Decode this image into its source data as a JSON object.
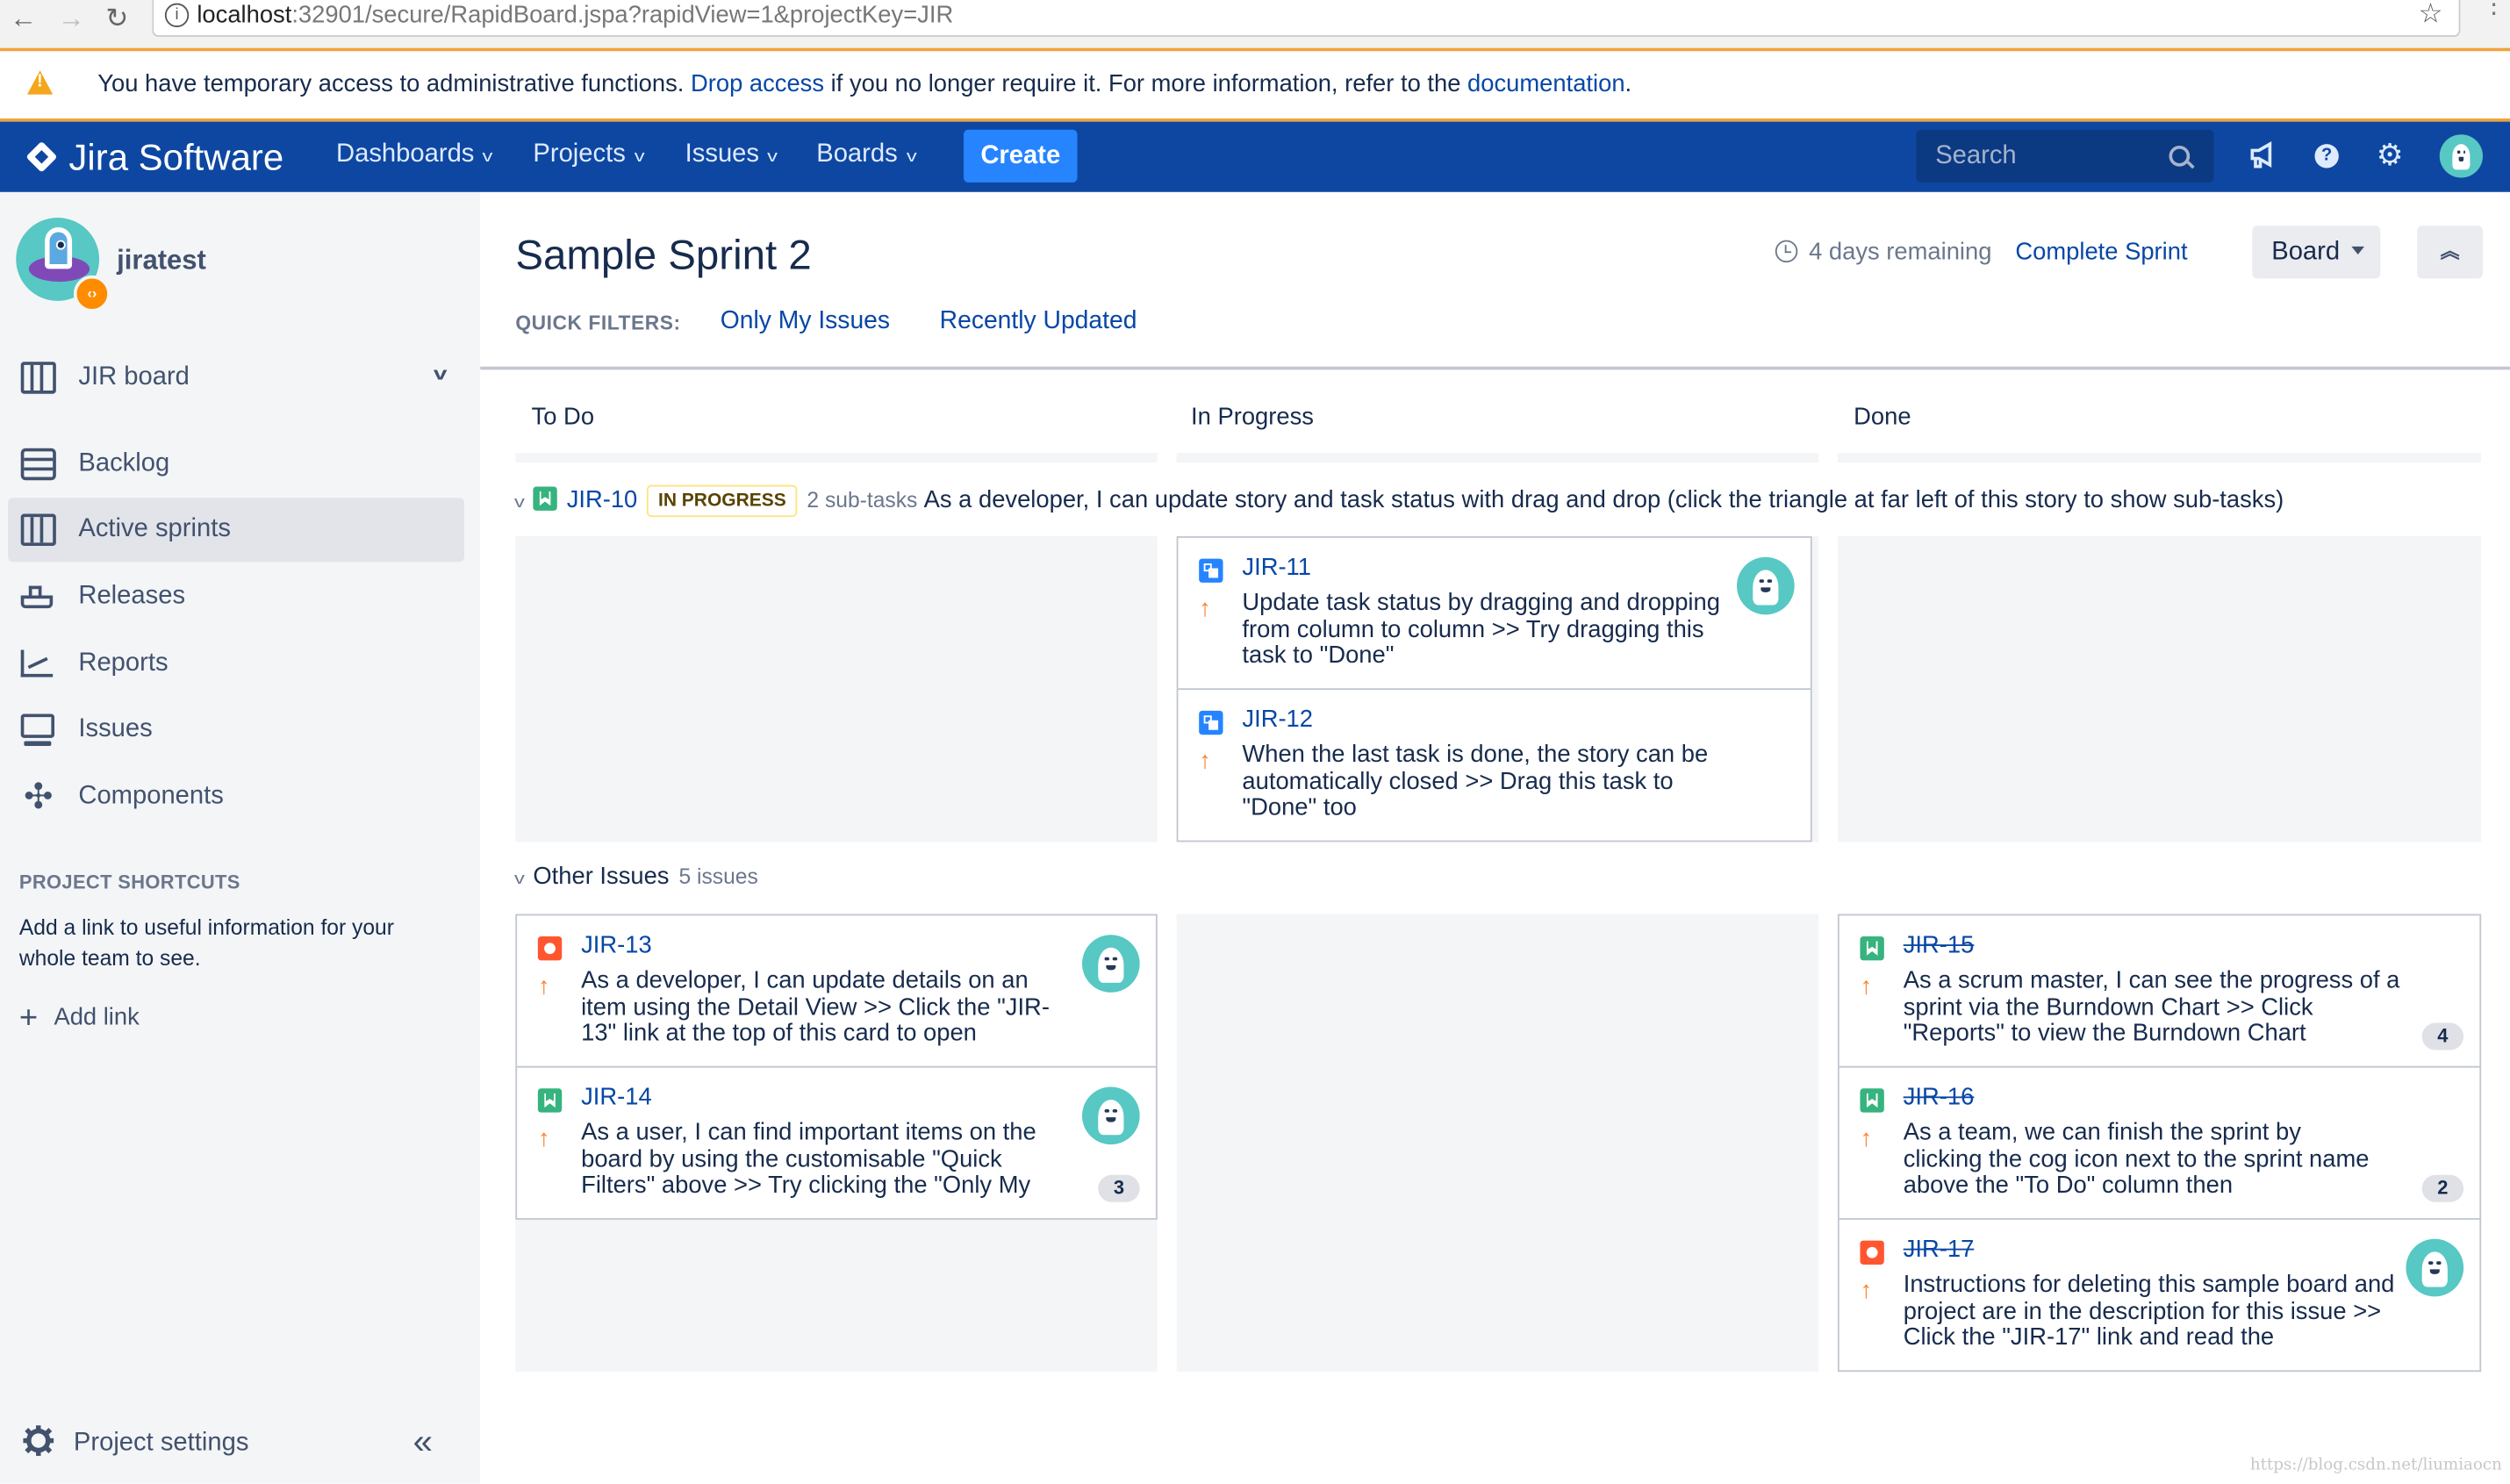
{
  "browser": {
    "url_host": "localhost",
    "url_rest": ":32901/secure/RapidBoard.jspa?rapidView=1&projectKey=JIR",
    "back_icon": "←",
    "forward_icon": "→",
    "reload_icon": "↻",
    "star_icon": "☆",
    "info_icon": "i",
    "menu_icon": "⋮"
  },
  "banner": {
    "text_before": "You have temporary access to administrative functions. ",
    "drop_access": "Drop access",
    "text_middle": " if you no longer require it. For more information, refer to the ",
    "documentation": "documentation",
    "text_after": "."
  },
  "topnav": {
    "logo": "Jira Software",
    "items": [
      {
        "label": "Dashboards",
        "chev": "v"
      },
      {
        "label": "Projects",
        "chev": "v"
      },
      {
        "label": "Issues",
        "chev": "v"
      },
      {
        "label": "Boards",
        "chev": "v"
      }
    ],
    "create": "Create",
    "search_placeholder": "Search",
    "notifications_icon": "megaphone",
    "help_icon": "?",
    "settings_icon": "⚙"
  },
  "sidebar": {
    "project_name": "jiratest",
    "project_badge": "‹›",
    "board": {
      "label": "JIR board",
      "chev": "v"
    },
    "items": [
      {
        "label": "Backlog",
        "icon": "backlog-icon"
      },
      {
        "label": "Active sprints",
        "icon": "sprint-icon",
        "active": true
      },
      {
        "label": "Releases",
        "icon": "release-icon"
      },
      {
        "label": "Reports",
        "icon": "reports-icon"
      },
      {
        "label": "Issues",
        "icon": "issues-icon"
      },
      {
        "label": "Components",
        "icon": "components-icon"
      }
    ],
    "components_glyph": "✣",
    "shortcuts_title": "PROJECT SHORTCUTS",
    "shortcuts_desc": "Add a link to useful information for your whole team to see.",
    "add_link": "Add link",
    "add_link_icon": "+",
    "project_settings": "Project settings",
    "collapse_icon": "«"
  },
  "main": {
    "sprint_title": "Sample Sprint 2",
    "remaining": "4 days remaining",
    "complete_sprint": "Complete Sprint",
    "board_button": "Board",
    "expand_icon": "⌃⌃",
    "quick_filters_label": "QUICK FILTERS:",
    "quick_filters": [
      "Only My Issues",
      "Recently Updated"
    ],
    "columns": [
      "To Do",
      "In Progress",
      "Done"
    ]
  },
  "swimlanes": [
    {
      "toggle": "v",
      "key": "JIR-10",
      "type": "story",
      "status": "IN PROGRESS",
      "subtasks": "2 sub-tasks",
      "summary": "As a developer, I can update story and task status with drag and drop (click the triangle at far left of this story to show sub-tasks)"
    },
    {
      "toggle": "v",
      "title": "Other Issues",
      "count": "5 issues"
    }
  ],
  "cards": {
    "jir11": {
      "key": "JIR-11",
      "type": "sub-task",
      "priority": "↑",
      "summary": "Update task status by dragging and dropping from column to column >> Try dragging this task to \"Done\"",
      "done": false
    },
    "jir12": {
      "key": "JIR-12",
      "type": "sub-task",
      "priority": "↑",
      "summary": "When the last task is done, the story can be automatically closed >> Drag this task to \"Done\" too",
      "done": false
    },
    "jir13": {
      "key": "JIR-13",
      "type": "bug",
      "priority": "↑",
      "summary": "As a developer, I can update details on an item using the Detail View >> Click the \"JIR-13\" link at the top of this card to open",
      "done": false
    },
    "jir14": {
      "key": "JIR-14",
      "type": "story",
      "priority": "↑",
      "summary": "As a user, I can find important items on the board by using the customisable \"Quick Filters\" above >> Try clicking the \"Only My",
      "estimate": "3",
      "done": false
    },
    "jir15": {
      "key": "JIR-15",
      "type": "story",
      "priority": "↑",
      "summary": "As a scrum master, I can see the progress of a sprint via the Burndown Chart >> Click \"Reports\" to view the Burndown Chart",
      "estimate": "4",
      "done": true
    },
    "jir16": {
      "key": "JIR-16",
      "type": "story",
      "priority": "↑",
      "summary": "As a team, we can finish the sprint by clicking the cog icon next to the sprint name above the \"To Do\" column then",
      "estimate": "2",
      "done": true
    },
    "jir17": {
      "key": "JIR-17",
      "type": "bug",
      "priority": "↑",
      "summary": "Instructions for deleting this sample board and project are in the description for this issue >> Click the \"JIR-17\" link and read the",
      "done": true
    }
  },
  "watermark": "https://blog.csdn.net/liumiaocn"
}
